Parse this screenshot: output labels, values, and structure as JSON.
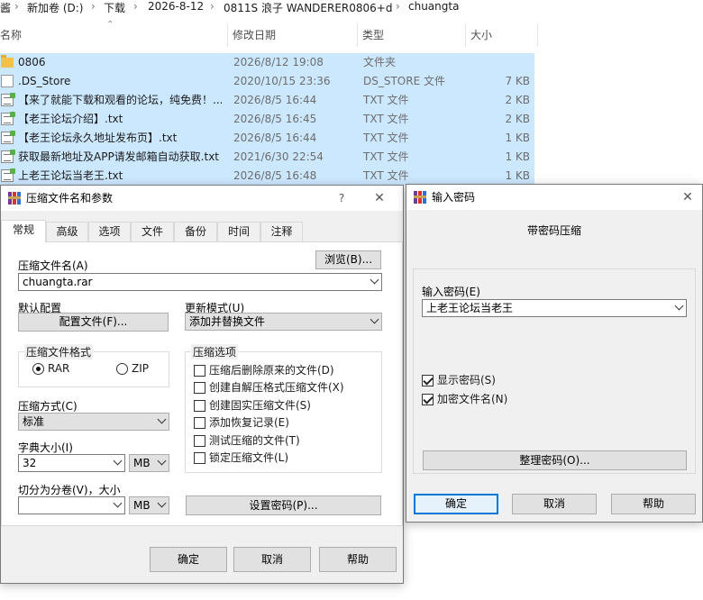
{
  "breadcrumb": [
    "酱",
    "新加卷 (D:)",
    "下载",
    "2026-8-12",
    "0811S 浪子 WANDERER0806+d",
    "chuangta"
  ],
  "columns": {
    "name": "名称",
    "date": "修改日期",
    "type": "类型",
    "size": "大小"
  },
  "files": [
    {
      "name": "0806",
      "date": "2026/8/12 19:08",
      "type": "文件夹",
      "size": "",
      "icon": "folder-icon"
    },
    {
      "name": ".DS_Store",
      "date": "2020/10/15 23:36",
      "type": "DS_STORE 文件",
      "size": "7 KB",
      "icon": "file-icon"
    },
    {
      "name": "【来了就能下载和观看的论坛，纯免费！...",
      "date": "2026/8/5 16:44",
      "type": "TXT 文件",
      "size": "2 KB",
      "icon": "txt-file-icon"
    },
    {
      "name": "【老王论坛介绍】.txt",
      "date": "2026/8/5 16:45",
      "type": "TXT 文件",
      "size": "2 KB",
      "icon": "txt-file-icon"
    },
    {
      "name": "【老王论坛永久地址发布页】.txt",
      "date": "2026/8/5 16:44",
      "type": "TXT 文件",
      "size": "1 KB",
      "icon": "txt-file-icon"
    },
    {
      "name": "获取最新地址及APP请发邮箱自动获取.txt",
      "date": "2021/6/30 22:54",
      "type": "TXT 文件",
      "size": "1 KB",
      "icon": "txt-file-icon"
    },
    {
      "name": "上老王论坛当老王.txt",
      "date": "2026/8/5 16:48",
      "type": "TXT 文件",
      "size": "1 KB",
      "icon": "txt-file-icon"
    }
  ],
  "archive_dialog": {
    "title": "压缩文件名和参数",
    "help_btn": "?",
    "close_btn": "✕",
    "tabs": [
      "常规",
      "高级",
      "选项",
      "文件",
      "备份",
      "时间",
      "注释"
    ],
    "archive_name_label": "压缩文件名(A)",
    "browse_label": "浏览(B)...",
    "archive_name_value": "chuangta.rar",
    "default_config_label": "默认配置",
    "profiles_label": "配置文件(F)...",
    "update_mode_label": "更新模式(U)",
    "update_mode_value": "添加并替换文件",
    "format_group": "压缩文件格式",
    "format_rar": "RAR",
    "format_zip": "ZIP",
    "options_group": "压缩选项",
    "options": [
      {
        "label": "压缩后删除原来的文件(D)",
        "checked": false
      },
      {
        "label": "创建自解压格式压缩文件(X)",
        "checked": false
      },
      {
        "label": "创建固实压缩文件(S)",
        "checked": false
      },
      {
        "label": "添加恢复记录(E)",
        "checked": false
      },
      {
        "label": "测试压缩的文件(T)",
        "checked": false
      },
      {
        "label": "锁定压缩文件(L)",
        "checked": false
      }
    ],
    "method_label": "压缩方式(C)",
    "method_value": "标准",
    "dict_label": "字典大小(I)",
    "dict_value": "32",
    "dict_unit": "MB",
    "split_label": "切分为分卷(V)，大小",
    "split_value": "",
    "split_unit": "MB",
    "set_password_label": "设置密码(P)...",
    "ok_label": "确定",
    "cancel_label": "取消",
    "help_label": "帮助"
  },
  "password_dialog": {
    "title": "输入密码",
    "close_btn": "✕",
    "heading": "带密码压缩",
    "enter_label": "输入密码(E)",
    "password_value": "上老王论坛当老王",
    "show_password": {
      "label": "显示密码(S)",
      "checked": true
    },
    "encrypt_names": {
      "label": "加密文件名(N)",
      "checked": true
    },
    "organize_label": "整理密码(O)...",
    "ok_label": "确定",
    "cancel_label": "取消",
    "help_label": "帮助"
  }
}
